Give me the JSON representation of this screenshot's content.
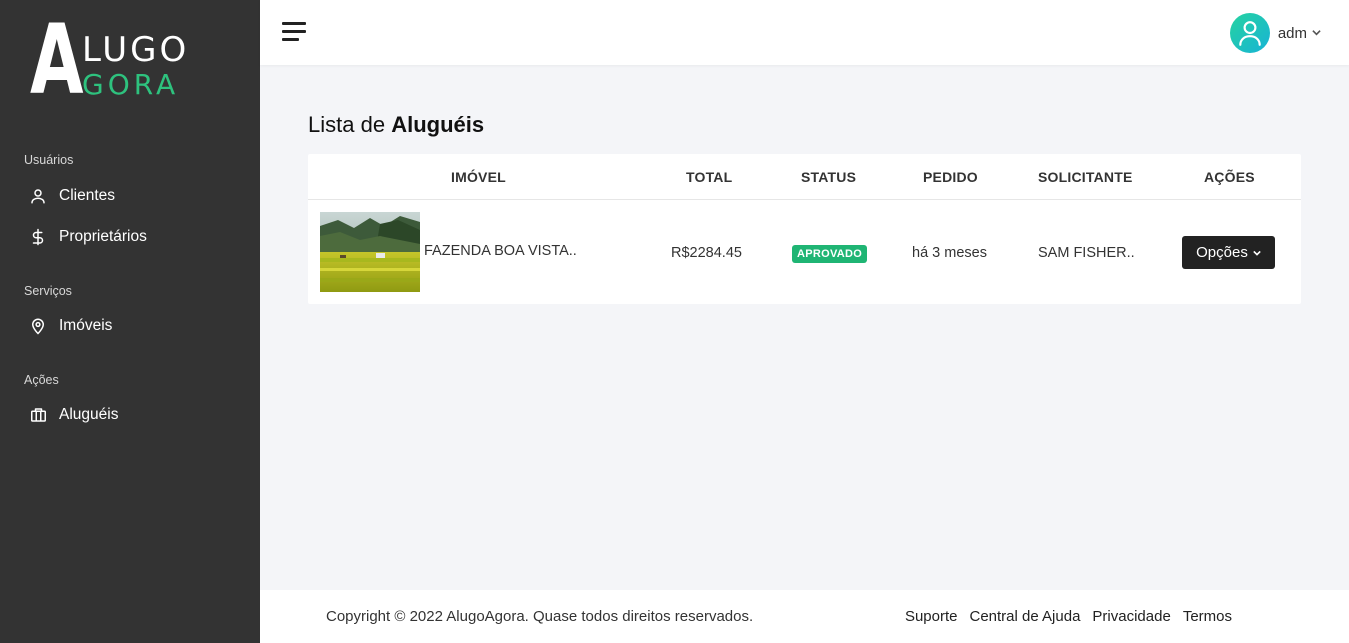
{
  "brand": {
    "logo_letter": "A",
    "logo_top": "LUGO",
    "logo_bottom": "GORA",
    "accent": "#2ec27e"
  },
  "sidebar": {
    "sections": [
      {
        "title": "Usuários",
        "items": [
          {
            "label": "Clientes",
            "icon": "user-icon"
          },
          {
            "label": "Proprietários",
            "icon": "dollar-icon"
          }
        ]
      },
      {
        "title": "Serviços",
        "items": [
          {
            "label": "Imóveis",
            "icon": "map-pin-icon"
          }
        ]
      },
      {
        "title": "Ações",
        "items": [
          {
            "label": "Aluguéis",
            "icon": "briefcase-icon"
          }
        ]
      }
    ]
  },
  "topbar": {
    "user_name": "adm",
    "menu_icon": "hamburger-icon",
    "avatar_icon": "user-avatar-icon"
  },
  "page": {
    "title_prefix": "Lista de",
    "title_bold": "Aluguéis"
  },
  "table": {
    "columns": [
      "IMÓVEL",
      "TOTAL",
      "STATUS",
      "PEDIDO",
      "SOLICITANTE",
      "AÇÕES"
    ],
    "rows": [
      {
        "imovel": "FAZENDA BOA VISTA..",
        "total": "R$2284.45",
        "status": "APROVADO",
        "pedido": "há 3 meses",
        "solicitante": "SAM FISHER..",
        "acao": "Opções"
      }
    ]
  },
  "footer": {
    "copyright": "Copyright © 2022 AlugoAgora. Quase todos direitos reservados.",
    "links": [
      "Suporte",
      "Central de Ajuda",
      "Privacidade",
      "Termos"
    ]
  }
}
